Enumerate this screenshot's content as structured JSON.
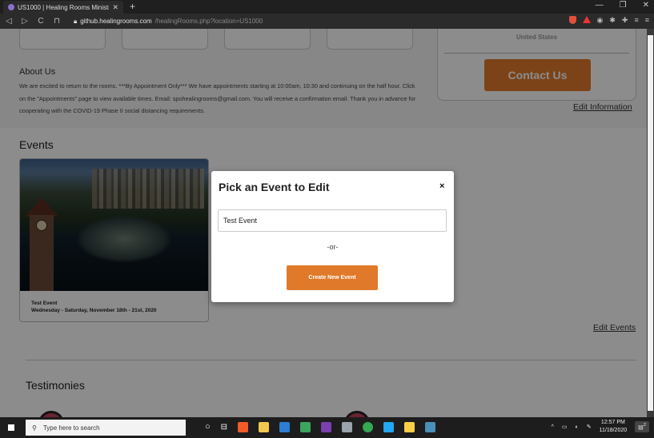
{
  "browser": {
    "tab_title": "US1000 | Healing Rooms Ministrie",
    "new_tab_glyph": "+",
    "url_domain": "github.healingrooms.com",
    "url_path": "/healingRooms.php?location=US1000",
    "win_minimize": "—",
    "win_restore": "❐",
    "win_close": "✕"
  },
  "info_card": {
    "country": "United States",
    "contact_label": "Contact Us",
    "edit_label": "Edit Information"
  },
  "about": {
    "heading": "About Us",
    "body": "We are excited to return to the rooms. ***By Appointment Only*** We have appointments starting at 10:00am, 10:30 and continuing on the half hour. Click on the \"Appointments\" page to view available times. Email: spohealingrooms@gmail.com. You will receive a confirmation email. Thank you in advance for cooperating with the COVID-19 Phase II social distancing requirements."
  },
  "events": {
    "heading": "Events",
    "card": {
      "name": "Test Event",
      "date": "Wednesday - Saturday, November 18th - 21st, 2020"
    },
    "edit_label": "Edit Events"
  },
  "testimonies": {
    "heading": "Testimonies"
  },
  "modal": {
    "title": "Pick an Event to Edit",
    "close_glyph": "×",
    "selected_event": "Test Event",
    "or_text": "-or-",
    "create_label": "Create New Event"
  },
  "taskbar": {
    "search_placeholder": "Type here to search",
    "time": "12:57 PM",
    "date": "11/18/2020",
    "notification_count": "2"
  },
  "colors": {
    "accent": "#e07a2a",
    "overlay": "rgba(0,0,0,0.45)"
  }
}
